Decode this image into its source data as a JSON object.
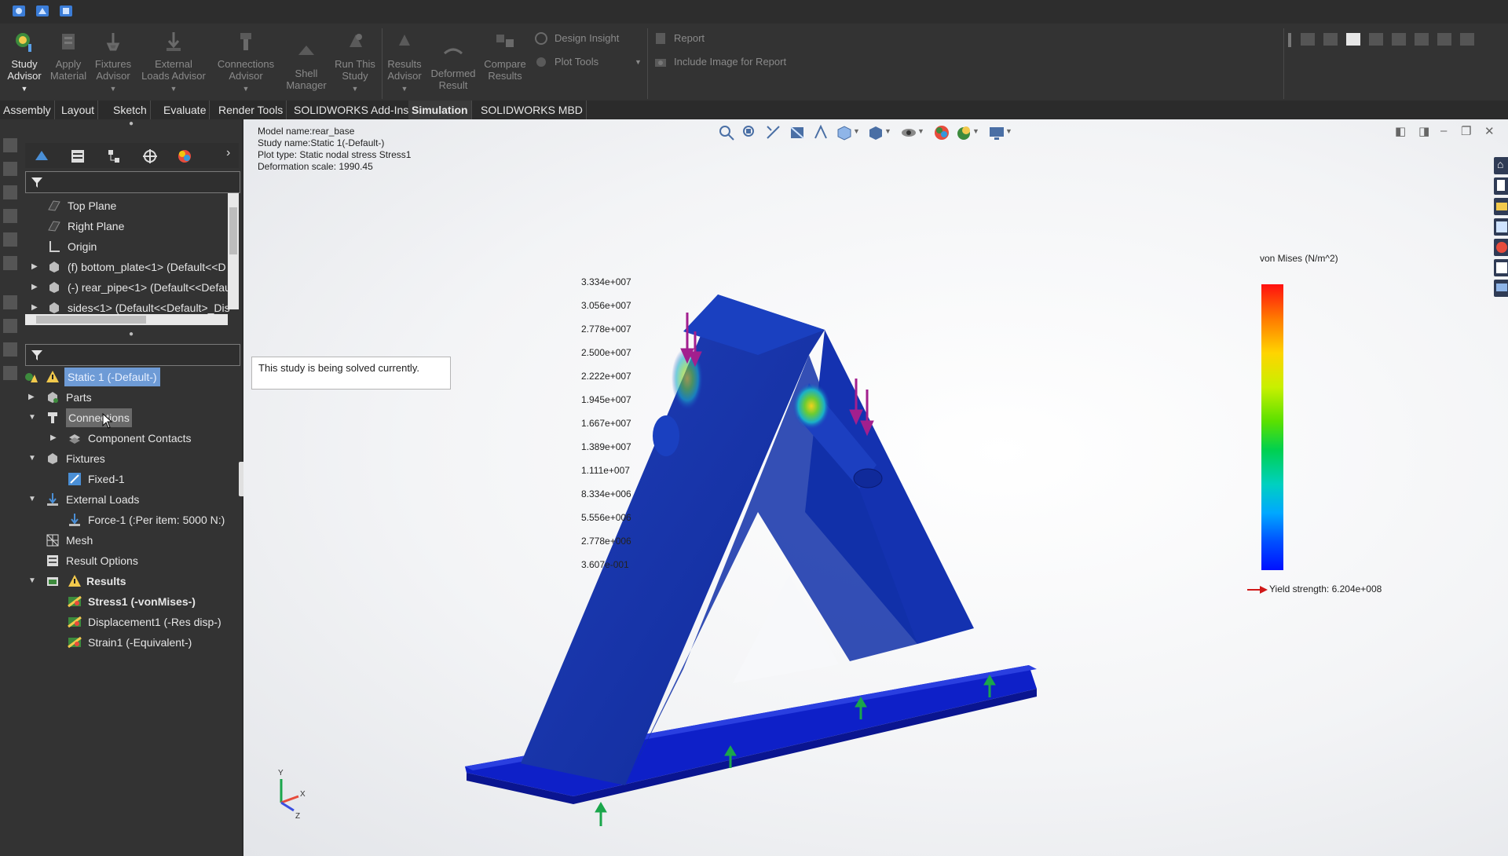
{
  "ribbon": {
    "buttons": [
      {
        "label": "Study Advisor",
        "active": true
      },
      {
        "label": "Apply Material"
      },
      {
        "label": "Fixtures Advisor"
      },
      {
        "label": "External Loads Advisor"
      },
      {
        "label": "Connections Advisor"
      },
      {
        "label": "Shell Manager"
      },
      {
        "label": "Run This Study"
      },
      {
        "label": "Results Advisor"
      },
      {
        "label": "Deformed Result"
      },
      {
        "label": "Compare Results"
      }
    ],
    "design_insight": "Design Insight",
    "plot_tools": "Plot Tools",
    "report": "Report",
    "include_image": "Include Image for Report"
  },
  "tabs": [
    "Assembly",
    "Layout",
    "Sketch",
    "Evaluate",
    "Render Tools",
    "SOLIDWORKS Add-Ins",
    "Simulation",
    "SOLIDWORKS MBD"
  ],
  "active_tab": "Simulation",
  "feature_tree": [
    {
      "label": "Top Plane"
    },
    {
      "label": "Right Plane"
    },
    {
      "label": "Origin"
    },
    {
      "label": "(f) bottom_plate<1> (Default<<D"
    },
    {
      "label": "(-) rear_pipe<1> (Default<<Defau"
    },
    {
      "label": "sides<1> (Default<<Default>_Dis"
    }
  ],
  "study_tree": [
    {
      "label": "Static 1 (-Default-)"
    },
    {
      "label": "Parts"
    },
    {
      "label": "Connections"
    },
    {
      "label": "Component Contacts"
    },
    {
      "label": "Fixtures"
    },
    {
      "label": "Fixed-1"
    },
    {
      "label": "External Loads"
    },
    {
      "label": "Force-1 (:Per item: 5000 N:)"
    },
    {
      "label": "Mesh"
    },
    {
      "label": "Result Options"
    },
    {
      "label": "Results"
    },
    {
      "label": "Stress1 (-vonMises-)"
    },
    {
      "label": "Displacement1 (-Res disp-)"
    },
    {
      "label": "Strain1 (-Equivalent-)"
    }
  ],
  "model_info": {
    "model": "Model name:rear_base",
    "study": "Study name:Static 1(-Default-)",
    "plot": "Plot type: Static nodal stress Stress1",
    "deformation": "Deformation scale: 1990.45"
  },
  "tooltip": "This study is being solved currently.",
  "legend": {
    "title": "von Mises (N/m^2)",
    "ticks": [
      "3.334e+007",
      "3.056e+007",
      "2.778e+007",
      "2.500e+007",
      "2.222e+007",
      "1.945e+007",
      "1.667e+007",
      "1.389e+007",
      "1.111e+007",
      "8.334e+006",
      "5.556e+006",
      "2.778e+006",
      "3.607e-001"
    ],
    "yield": "Yield strength: 6.204e+008"
  },
  "colors": {
    "accent": "#4a8fd6",
    "highlight": "#6e9bd6",
    "force": "#a21f8e",
    "fixture": "#1aa64b"
  }
}
